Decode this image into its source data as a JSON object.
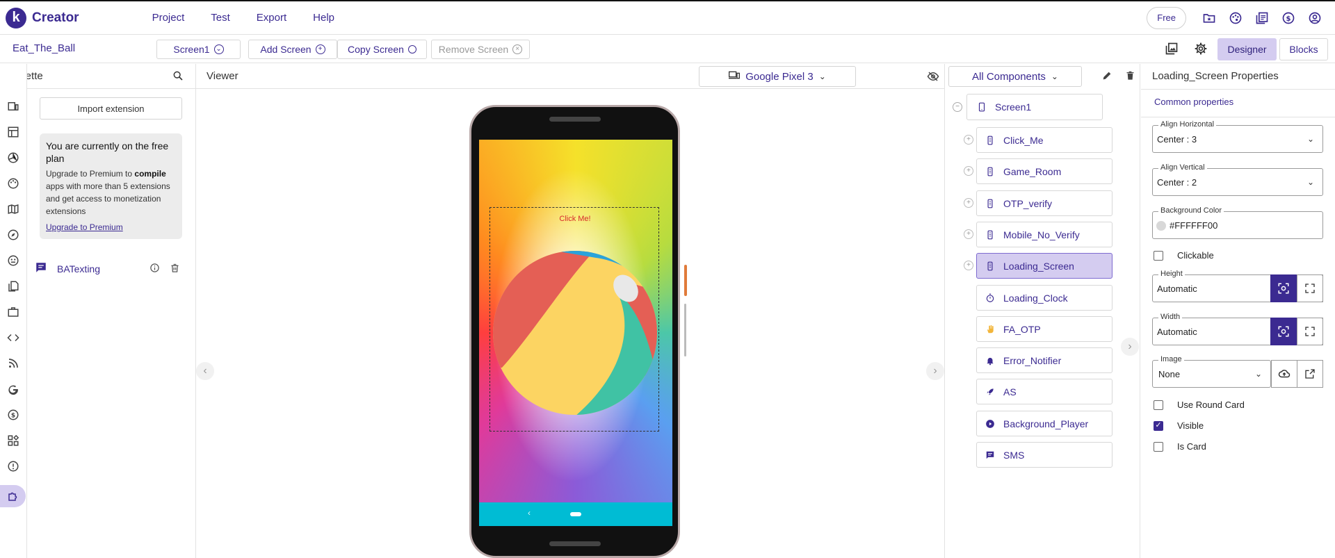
{
  "app": {
    "logo_letter": "k",
    "title": "Creator",
    "accent": "#3b2a91",
    "accent_light": "#d4ccf0"
  },
  "menu": {
    "items": [
      "Project",
      "Test",
      "Export",
      "Help"
    ]
  },
  "top_right": {
    "plan_label": "Free",
    "icons": [
      "folder-star-icon",
      "palette-icon",
      "library-icon",
      "dollar-icon",
      "account-icon"
    ]
  },
  "screenbar": {
    "project_name": "Eat_The_Ball",
    "screen_selector": "Screen1",
    "add_screen": "Add Screen",
    "copy_screen": "Copy Screen",
    "remove_screen": "Remove Screen",
    "designer": "Designer",
    "blocks": "Blocks"
  },
  "palette": {
    "title": "Palette",
    "import_extension": "Import extension",
    "promo_title": "You are currently on the free plan",
    "promo_pre": "Upgrade to Premium to ",
    "promo_bold": "compile",
    "promo_post": " apps with more than 5 extensions and get access to monetization extensions",
    "promo_link": "Upgrade to Premium",
    "extension_name": "BATexting"
  },
  "viewer": {
    "title": "Viewer",
    "device": "Google Pixel 3",
    "button_text": "Click Me!",
    "navbar_color": "#00bcd4"
  },
  "components": {
    "filter": "All Components",
    "root": "Screen1",
    "items": [
      {
        "name": "Click_Me",
        "icon": "phone-icon",
        "expandable": true,
        "selected": false
      },
      {
        "name": "Game_Room",
        "icon": "phone-icon",
        "expandable": true,
        "selected": false
      },
      {
        "name": "OTP_verify",
        "icon": "phone-icon",
        "expandable": true,
        "selected": false
      },
      {
        "name": "Mobile_No_Verify",
        "icon": "phone-icon",
        "expandable": true,
        "selected": false
      },
      {
        "name": "Loading_Screen",
        "icon": "phone-icon",
        "expandable": true,
        "selected": true
      },
      {
        "name": "Loading_Clock",
        "icon": "timer-icon",
        "expandable": false,
        "selected": false
      },
      {
        "name": "FA_OTP",
        "icon": "hand-icon",
        "expandable": false,
        "selected": false
      },
      {
        "name": "Error_Notifier",
        "icon": "bell-icon",
        "expandable": false,
        "selected": false
      },
      {
        "name": "AS",
        "icon": "rocket-icon",
        "expandable": false,
        "selected": false
      },
      {
        "name": "Background_Player",
        "icon": "play-icon",
        "expandable": false,
        "selected": false
      },
      {
        "name": "SMS",
        "icon": "message-icon",
        "expandable": false,
        "selected": false
      }
    ]
  },
  "properties": {
    "title": "Loading_Screen Properties",
    "section": "Common properties",
    "align_horizontal_label": "Align Horizontal",
    "align_horizontal_value": "Center : 3",
    "align_vertical_label": "Align Vertical",
    "align_vertical_value": "Center : 2",
    "background_color_label": "Background Color",
    "background_color_value": "#FFFFFF00",
    "clickable_label": "Clickable",
    "clickable": false,
    "height_label": "Height",
    "height_value": "Automatic",
    "width_label": "Width",
    "width_value": "Automatic",
    "image_label": "Image",
    "image_value": "None",
    "use_round_card_label": "Use Round Card",
    "use_round_card": false,
    "visible_label": "Visible",
    "visible": true,
    "is_card_label": "Is Card",
    "is_card": false
  }
}
